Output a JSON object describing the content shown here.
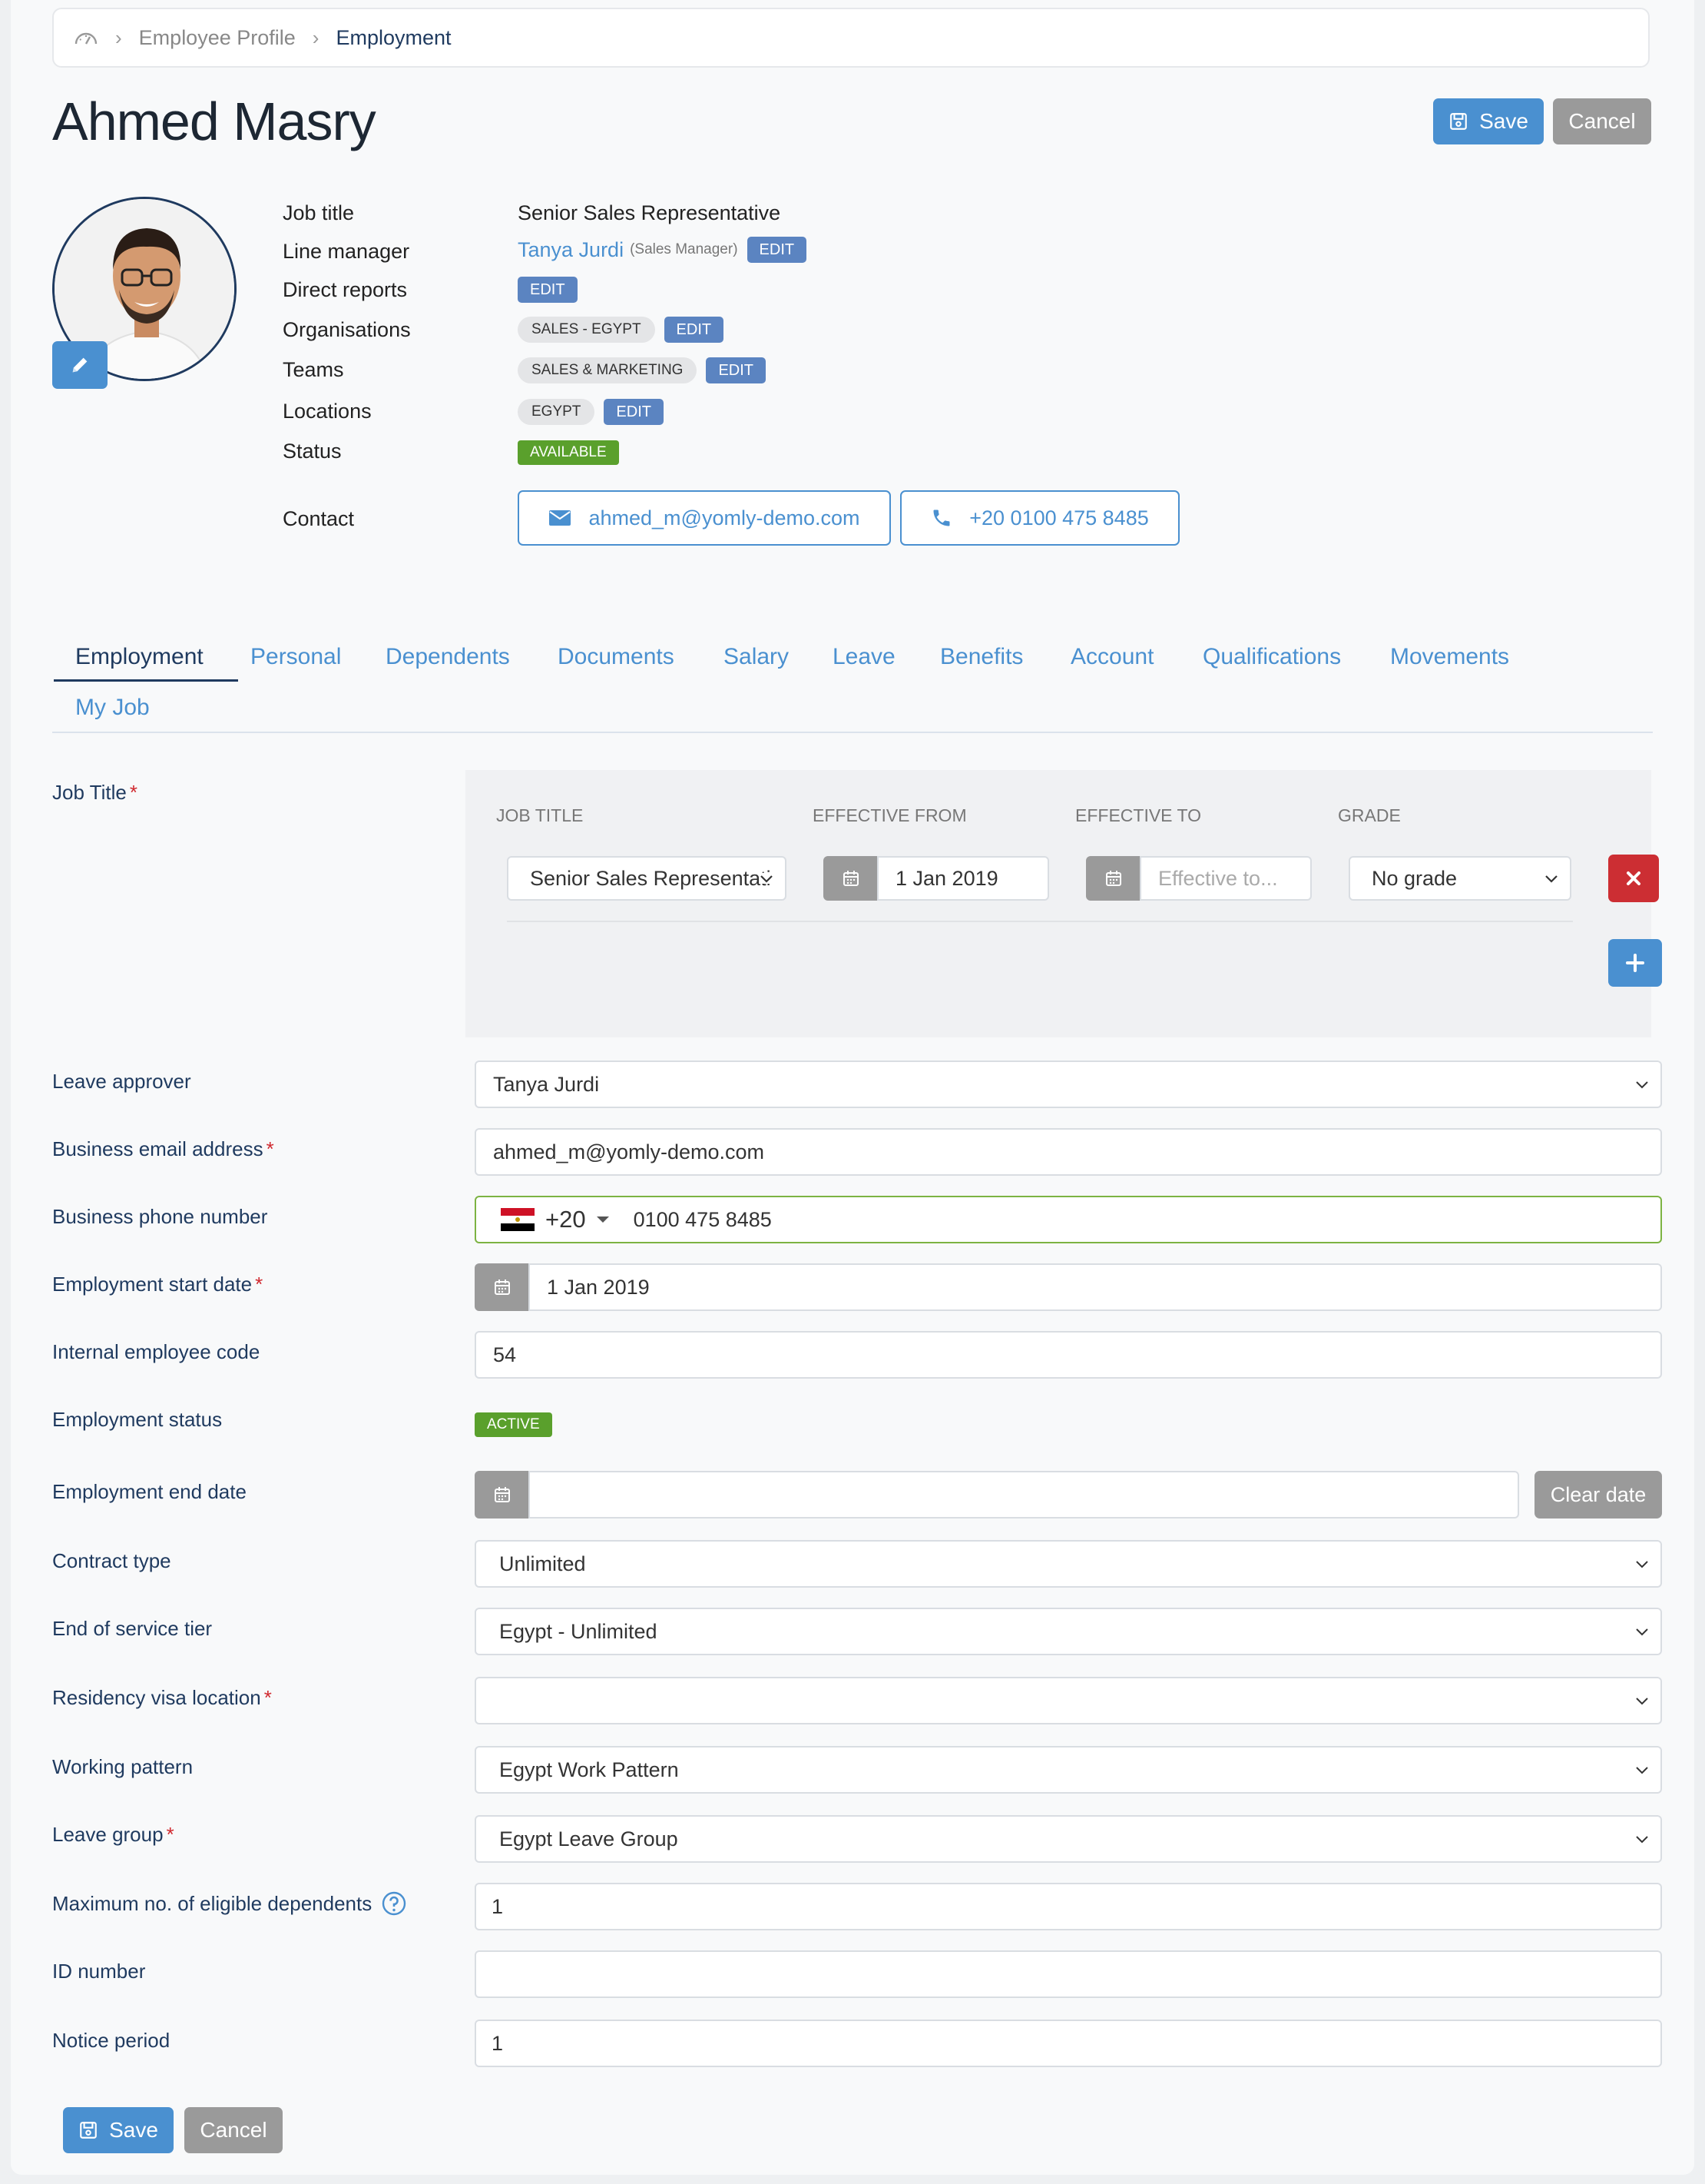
{
  "breadcrumb": {
    "item1": "Employee Profile",
    "item2": "Employment"
  },
  "page_title": "Ahmed Masry",
  "header_buttons": {
    "save": "Save",
    "cancel": "Cancel"
  },
  "profile": {
    "job_title_label": "Job title",
    "job_title_value": "Senior Sales Representative",
    "line_manager_label": "Line manager",
    "line_manager_name": "Tanya Jurdi",
    "line_manager_role": "(Sales Manager)",
    "direct_reports_label": "Direct reports",
    "organisations_label": "Organisations",
    "organisation_chip": "SALES - EGYPT",
    "teams_label": "Teams",
    "team_chip": "SALES & MARKETING",
    "locations_label": "Locations",
    "location_chip": "EGYPT",
    "status_label": "Status",
    "status_value": "AVAILABLE",
    "contact_label": "Contact",
    "email": "ahmed_m@yomly-demo.com",
    "phone": "+20 0100 475 8485",
    "edit_label": "EDIT"
  },
  "tabs": [
    "Employment",
    "Personal",
    "Dependents",
    "Documents",
    "Salary",
    "Leave",
    "Benefits",
    "Account",
    "Qualifications",
    "Movements",
    "My Job"
  ],
  "job_title_section": {
    "label": "Job Title",
    "col_job_title": "JOB TITLE",
    "col_effective_from": "EFFECTIVE FROM",
    "col_effective_to": "EFFECTIVE TO",
    "col_grade": "GRADE",
    "job_title_value": "Senior Sales Representati",
    "effective_from": "1 Jan 2019",
    "effective_to_placeholder": "Effective to...",
    "grade": "No grade"
  },
  "fields": {
    "leave_approver": {
      "label": "Leave approver",
      "value": "Tanya Jurdi"
    },
    "business_email": {
      "label": "Business email address",
      "value": "ahmed_m@yomly-demo.com"
    },
    "business_phone": {
      "label": "Business phone number",
      "code": "+20",
      "value": "0100 475 8485"
    },
    "start_date": {
      "label": "Employment start date",
      "value": "1 Jan 2019"
    },
    "employee_code": {
      "label": "Internal employee code",
      "value": "54"
    },
    "employment_status": {
      "label": "Employment status",
      "value": "ACTIVE"
    },
    "end_date": {
      "label": "Employment end date",
      "value": "",
      "clear_label": "Clear date"
    },
    "contract_type": {
      "label": "Contract type",
      "value": "Unlimited"
    },
    "end_of_service": {
      "label": "End of service tier",
      "value": "Egypt - Unlimited"
    },
    "residency_visa": {
      "label": "Residency visa location",
      "value": ""
    },
    "working_pattern": {
      "label": "Working pattern",
      "value": "Egypt Work Pattern"
    },
    "leave_group": {
      "label": "Leave group",
      "value": "Egypt Leave Group"
    },
    "max_dependents": {
      "label": "Maximum no. of eligible dependents",
      "value": "1"
    },
    "id_number": {
      "label": "ID number",
      "value": ""
    },
    "notice_period": {
      "label": "Notice period",
      "value": "1"
    }
  },
  "required_mark": "*",
  "footer_buttons": {
    "save": "Save",
    "cancel": "Cancel"
  },
  "colors": {
    "primary": "#4a90d0",
    "navy": "#1f3a5f",
    "danger": "#cc2e33",
    "success": "#5aa02c",
    "muted_button": "#9a9a9a"
  }
}
